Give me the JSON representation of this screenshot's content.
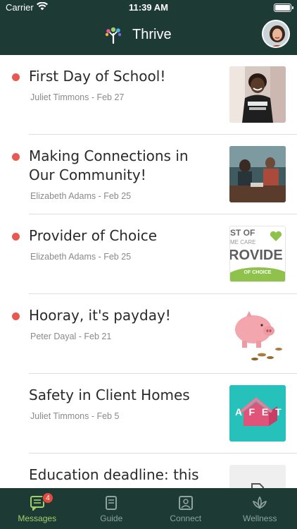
{
  "status_bar": {
    "carrier": "Carrier",
    "time": "11:39 AM"
  },
  "header": {
    "app_title": "Thrive"
  },
  "feed": [
    {
      "title": "First Day of School!",
      "author": "Juliet Timmons",
      "date": "Feb 27",
      "meta": "Juliet Timmons - Feb 27",
      "unread": true,
      "thumb": "child-photo"
    },
    {
      "title": "Making Connections in Our Community!",
      "author": "Elizabeth Adams",
      "date": "Feb 25",
      "meta": "Elizabeth Adams - Feb 25",
      "unread": true,
      "thumb": "meeting-photo"
    },
    {
      "title": "Provider of Choice",
      "author": "Elizabeth Adams",
      "date": "Feb 25",
      "meta": "Elizabeth Adams - Feb 25",
      "unread": true,
      "thumb": "provider-badge",
      "thumb_text": {
        "line1": "ST OF",
        "line2": "ME CARE",
        "line3": "ROVIDE",
        "line4": "OF CHOICE"
      }
    },
    {
      "title": "Hooray, it's payday!",
      "author": "Peter Dayal",
      "date": "Feb 21",
      "meta": "Peter Dayal - Feb 21",
      "unread": true,
      "thumb": "piggy-bank"
    },
    {
      "title": "Safety in Client Homes",
      "author": "Juliet Timmons",
      "date": "Feb 5",
      "meta": "Juliet Timmons - Feb 5",
      "unread": false,
      "thumb": "safety-house",
      "thumb_text": {
        "letters": "A F E T"
      }
    },
    {
      "title": "Education deadline: this",
      "author": "",
      "date": "",
      "meta": "",
      "unread": false,
      "thumb": "document-placeholder"
    }
  ],
  "tabbar": {
    "tabs": [
      {
        "label": "Messages",
        "icon": "message-icon",
        "active": true,
        "badge": "4"
      },
      {
        "label": "Guide",
        "icon": "book-icon",
        "active": false
      },
      {
        "label": "Connect",
        "icon": "contact-icon",
        "active": false
      },
      {
        "label": "Wellness",
        "icon": "lotus-icon",
        "active": false
      }
    ]
  },
  "colors": {
    "header_bg": "#1d3a35",
    "unread_dot": "#e85a4f",
    "active_tab": "#9fd06a",
    "badge": "#e24a3e"
  }
}
